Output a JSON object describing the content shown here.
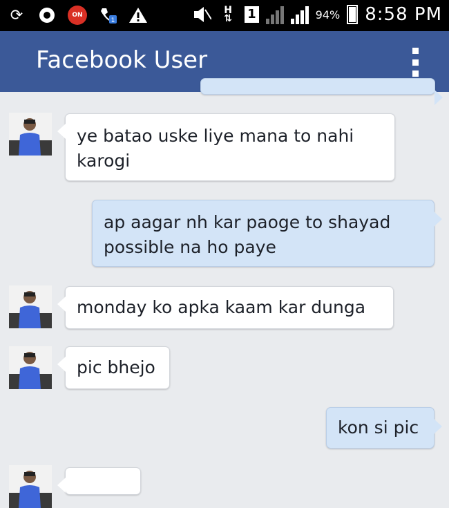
{
  "status_bar": {
    "indicator_sim": "1",
    "battery": "94%",
    "time": "8:58 PM",
    "icons": [
      "sync-icon",
      "location-icon",
      "call-recorder-icon",
      "missed-call-icon",
      "warning-icon",
      "mute-icon",
      "data-arrows-icon",
      "sim-icon",
      "signal-icon",
      "battery-icon"
    ]
  },
  "app_bar": {
    "title": "Facebook User",
    "menu_icon": "overflow-menu-icon",
    "color": "#3b5998"
  },
  "messages": [
    {
      "direction": "outgoing",
      "text": ""
    },
    {
      "direction": "incoming",
      "lines": [
        "ye batao uske liye mana to nahi",
        "karogi"
      ]
    },
    {
      "direction": "outgoing",
      "lines": [
        "ap aagar nh kar paoge to shayad",
        "possible na ho paye"
      ]
    },
    {
      "direction": "incoming",
      "lines": [
        "monday ko apka kaam kar dunga"
      ]
    },
    {
      "direction": "incoming",
      "lines": [
        "pic bhejo"
      ]
    },
    {
      "direction": "outgoing",
      "lines": [
        "kon si pic"
      ]
    },
    {
      "direction": "incoming",
      "text": ""
    }
  ]
}
